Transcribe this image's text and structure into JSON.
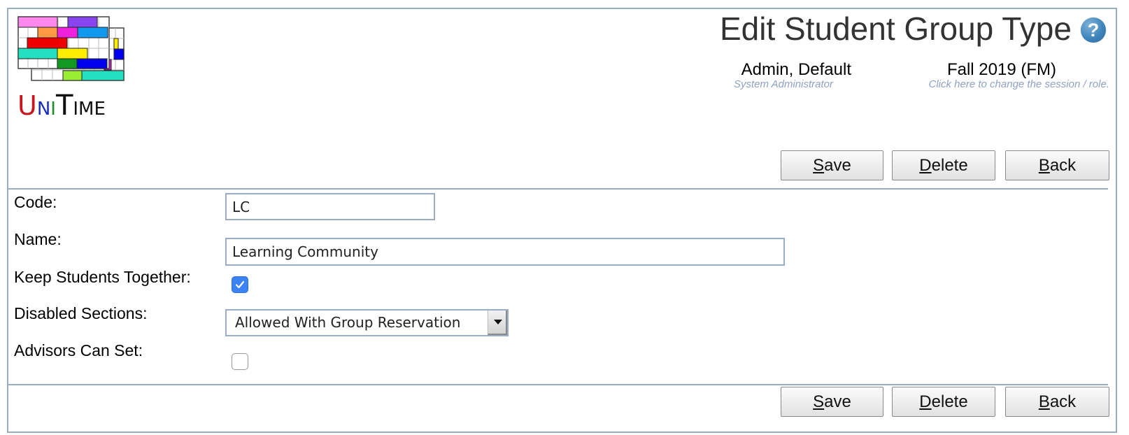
{
  "app": {
    "logo_text": {
      "u": "U",
      "n": "N",
      "i": "I",
      "t": "T",
      "ime": "IME"
    }
  },
  "header": {
    "title": "Edit Student Group Type",
    "help_icon": "help-question-icon",
    "user": {
      "name": "Admin, Default",
      "role": "System Administrator"
    },
    "session": {
      "name": "Fall 2019 (FM)",
      "hint": "Click here to change the session / role."
    }
  },
  "toolbar": {
    "save": {
      "access_key": "S",
      "rest": "ave"
    },
    "delete": {
      "access_key": "D",
      "rest": "elete"
    },
    "back": {
      "access_key": "B",
      "rest": "ack"
    }
  },
  "form": {
    "code": {
      "label": "Code:",
      "value": "LC"
    },
    "name": {
      "label": "Name:",
      "value": "Learning Community"
    },
    "keep_together": {
      "label": "Keep Students Together:",
      "checked": true
    },
    "disabled_sections": {
      "label": "Disabled Sections:",
      "selected": "Allowed With Group Reservation"
    },
    "advisors_can_set": {
      "label": "Advisors Can Set:",
      "checked": false
    }
  },
  "colors": {
    "border": "#9cacc4",
    "checkbox_checked": "#3b82f6",
    "subtext": "#8fa1c4"
  }
}
